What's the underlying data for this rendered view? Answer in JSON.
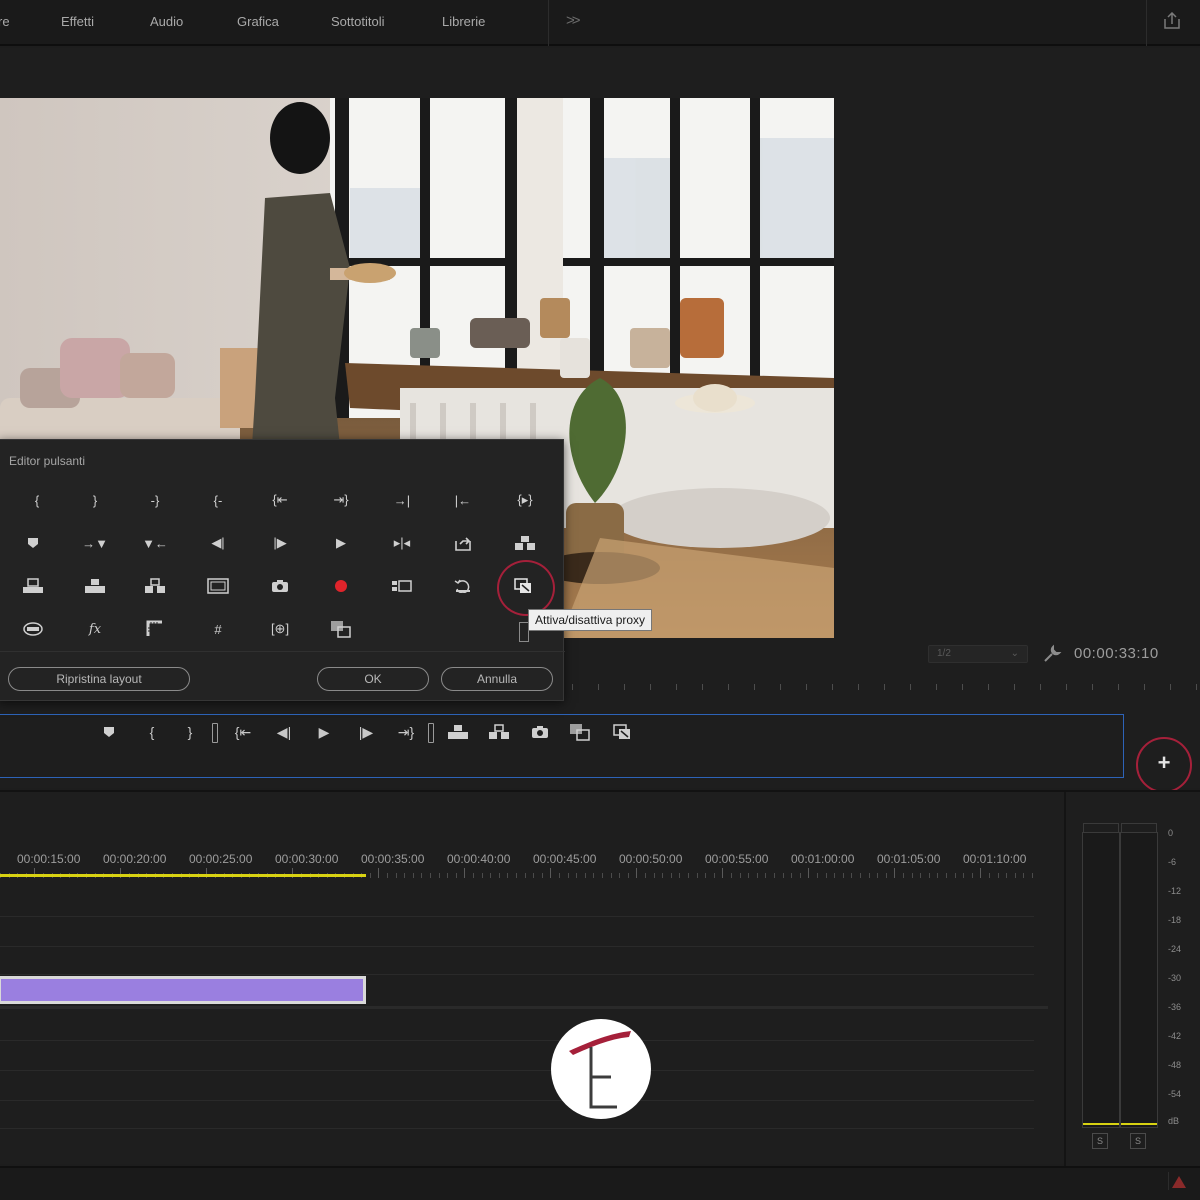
{
  "menu": {
    "items": [
      "re",
      "Effetti",
      "Audio",
      "Grafica",
      "Sottotitoli",
      "Librerie"
    ]
  },
  "monitor": {
    "resolution": "1/2",
    "timecode": "00:00:33:10"
  },
  "dialog": {
    "title": "Editor pulsanti",
    "reset_label": "Ripristina layout",
    "ok_label": "OK",
    "cancel_label": "Annulla",
    "tooltip": "Attiva/disattiva proxy"
  },
  "timeline": {
    "ruler": [
      "00:00:15:00",
      "00:00:20:00",
      "00:00:25:00",
      "00:00:30:00",
      "00:00:35:00",
      "00:00:40:00",
      "00:00:45:00",
      "00:00:50:00",
      "00:00:55:00",
      "00:01:00:00",
      "00:01:05:00",
      "00:01:10:00"
    ]
  },
  "meters": {
    "scale": [
      "0",
      "-6",
      "-12",
      "-18",
      "-24",
      "-30",
      "-36",
      "-42",
      "-48",
      "-54",
      "dB"
    ],
    "solo_left": "S",
    "solo_right": "S"
  },
  "colors": {
    "accent_blue": "#2d63b8",
    "highlight_red": "#a5203a",
    "clip_purple": "#9a7fe0",
    "work_area_yellow": "#d8d212",
    "record_red": "#e0242b"
  }
}
